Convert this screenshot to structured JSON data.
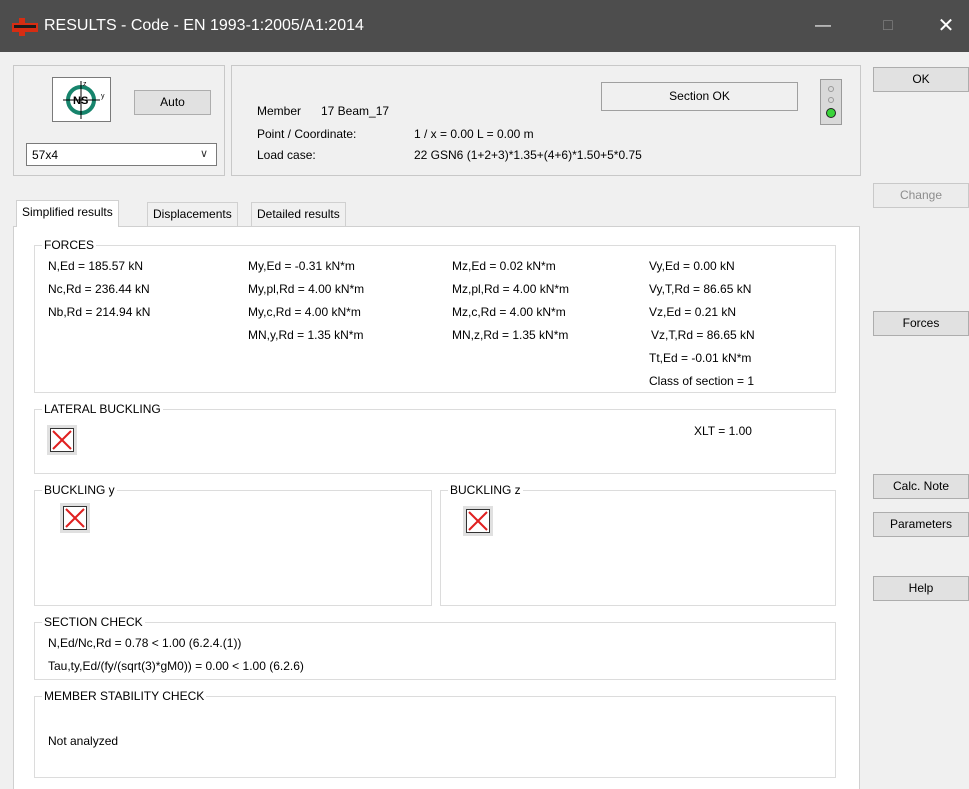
{
  "window": {
    "title": "RESULTS - Code - EN 1993-1:2005/A1:2014",
    "minimize_glyph": "—",
    "maximize_glyph": "□",
    "close_glyph": "✕"
  },
  "section": {
    "icon_text": "NS",
    "auto_label": "Auto",
    "profile": "57x4"
  },
  "info": {
    "member_label": "Member",
    "member_value": "17  Beam_17",
    "point_label": "Point / Coordinate:",
    "point_value": "1 / x = 0.00 L = 0.00 m",
    "loadcase_label": "Load case:",
    "loadcase_value": "22 GSN6  (1+2+3)*1.35+(4+6)*1.50+5*0.75",
    "status": "Section OK"
  },
  "buttons": {
    "ok": "OK",
    "change": "Change",
    "forces": "Forces",
    "calc_note": "Calc. Note",
    "parameters": "Parameters",
    "help": "Help"
  },
  "tabs": [
    "Simplified results",
    "Displacements",
    "Detailed results"
  ],
  "forces": {
    "title": "FORCES",
    "col1": [
      "N,Ed = 185.57 kN",
      "Nc,Rd = 236.44 kN",
      "Nb,Rd = 214.94 kN"
    ],
    "col2": [
      "My,Ed = -0.31 kN*m",
      "My,pl,Rd = 4.00 kN*m",
      "My,c,Rd = 4.00 kN*m",
      "MN,y,Rd = 1.35 kN*m"
    ],
    "col3": [
      "Mz,Ed = 0.02 kN*m",
      "Mz,pl,Rd = 4.00 kN*m",
      "Mz,c,Rd = 4.00 kN*m",
      "MN,z,Rd = 1.35 kN*m"
    ],
    "col4": [
      "Vy,Ed = 0.00 kN",
      "Vy,T,Rd = 86.65 kN",
      "Vz,Ed = 0.21 kN",
      "Vz,T,Rd = 86.65 kN",
      "Tt,Ed = -0.01 kN*m",
      "Class of section = 1"
    ]
  },
  "lateral_buckling": {
    "title": "LATERAL BUCKLING",
    "xlt": "XLT = 1.00"
  },
  "buckling_y": {
    "title": "BUCKLING y"
  },
  "buckling_z": {
    "title": "BUCKLING z"
  },
  "section_check": {
    "title": "SECTION CHECK",
    "lines": [
      "N,Ed/Nc,Rd = 0.78 < 1.00   (6.2.4.(1))",
      "Tau,ty,Ed/(fy/(sqrt(3)*gM0)) = 0.00 < 1.00   (6.2.6)"
    ]
  },
  "member_stability": {
    "title": "MEMBER STABILITY CHECK",
    "text": "Not analyzed"
  },
  "colors": {
    "titlebar": "#4d4d4d",
    "status_light": "#39d339",
    "cross": "#e02020"
  }
}
